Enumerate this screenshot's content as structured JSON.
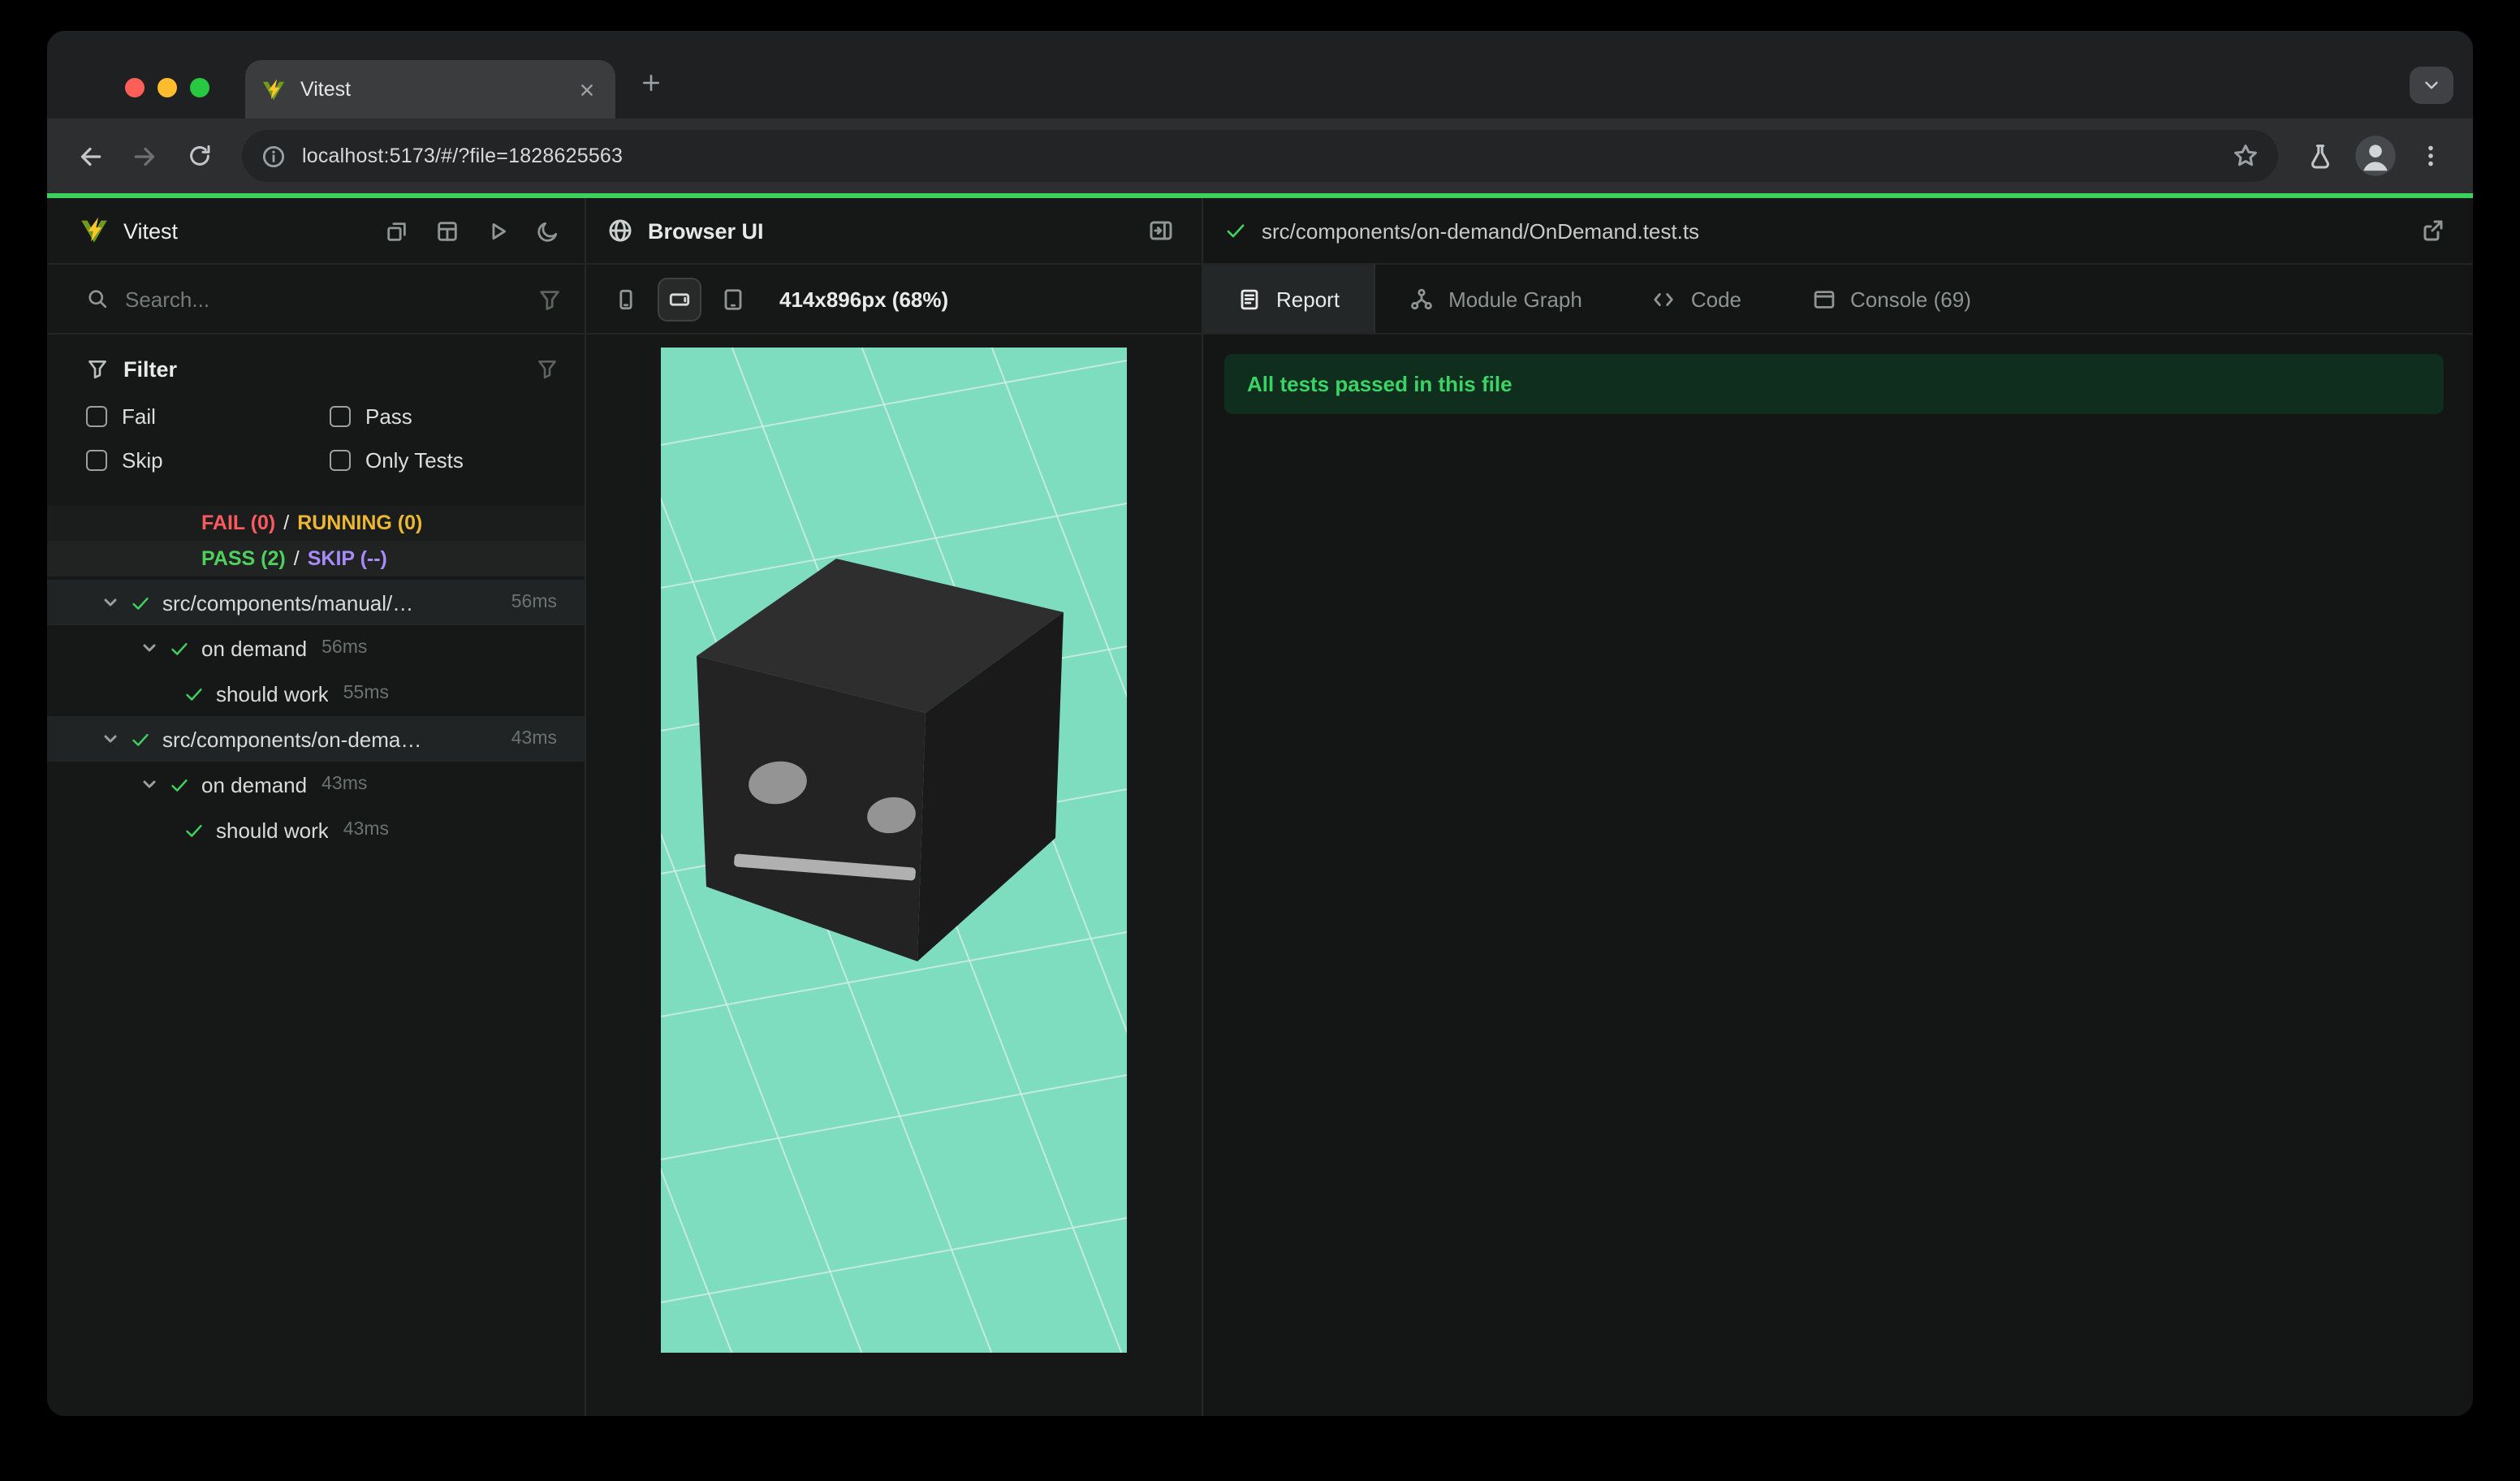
{
  "browser": {
    "tab_title": "Vitest",
    "url": "localhost:5173/#/?file=1828625563"
  },
  "sidebar": {
    "app_name": "Vitest",
    "search_placeholder": "Search...",
    "filter": {
      "title": "Filter",
      "options": [
        "Fail",
        "Pass",
        "Skip",
        "Only Tests"
      ]
    },
    "status": {
      "fail": "FAIL (0)",
      "running": "RUNNING (0)",
      "pass": "PASS (2)",
      "skip": "SKIP (--)",
      "sep": "/"
    },
    "tree": [
      {
        "label": "src/components/manual/…",
        "duration": "56ms"
      },
      {
        "label": "on demand",
        "duration": "56ms"
      },
      {
        "label": "should work",
        "duration": "55ms"
      },
      {
        "label": "src/components/on-dema…",
        "duration": "43ms"
      },
      {
        "label": "on demand",
        "duration": "43ms"
      },
      {
        "label": "should work",
        "duration": "43ms"
      }
    ]
  },
  "browser_panel": {
    "title": "Browser UI",
    "viewport_size": "414x896px (68%)"
  },
  "report_panel": {
    "file_path": "src/components/on-demand/OnDemand.test.ts",
    "tabs": [
      "Report",
      "Module Graph",
      "Code",
      "Console (69)"
    ],
    "active_tab": "Report",
    "banner": "All tests passed in this file"
  },
  "colors": {
    "progress_green": "#3ed05c",
    "pass_green": "#4fd05e",
    "fail_red": "#fb5a5f",
    "running_yellow": "#ecb732",
    "skip_purple": "#a78bfa",
    "viewport_teal": "#7EDCBF",
    "banner_bg": "#0f2e1d"
  }
}
